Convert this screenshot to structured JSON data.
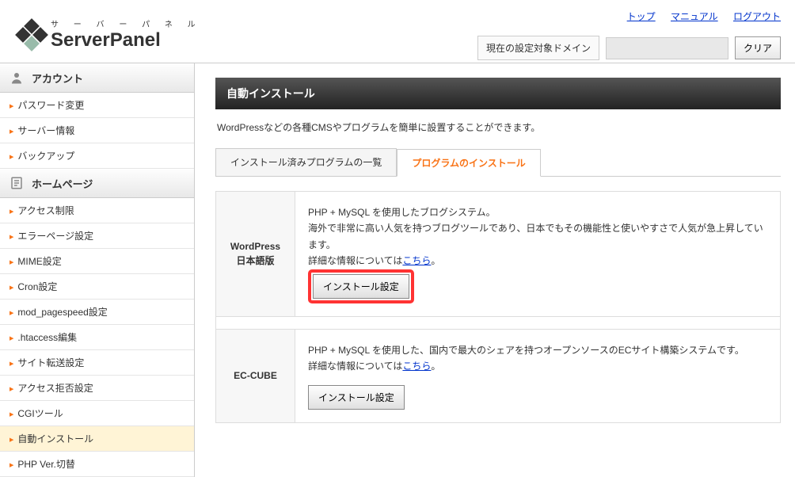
{
  "header": {
    "logo_kana": "サ ー バ ー パ ネ ル",
    "logo_main": "ServerPanel",
    "top_links": [
      "トップ",
      "マニュアル",
      "ログアウト"
    ],
    "domain_label": "現在の設定対象ドメイン",
    "clear_button": "クリア"
  },
  "sidebar": {
    "sections": [
      {
        "title": "アカウント",
        "items": [
          "パスワード変更",
          "サーバー情報",
          "バックアップ"
        ]
      },
      {
        "title": "ホームページ",
        "items": [
          "アクセス制限",
          "エラーページ設定",
          "MIME設定",
          "Cron設定",
          "mod_pagespeed設定",
          ".htaccess編集",
          "サイト転送設定",
          "アクセス拒否設定",
          "CGIツール",
          "自動インストール",
          "PHP Ver.切替"
        ]
      }
    ],
    "active_item": "自動インストール"
  },
  "main": {
    "title": "自動インストール",
    "description": "WordPressなどの各種CMSやプログラムを簡単に設置することができます。",
    "tabs": [
      "インストール済みプログラムの一覧",
      "プログラムのインストール"
    ],
    "active_tab_index": 1,
    "programs": [
      {
        "name": "WordPress\n日本語版",
        "desc_lines": [
          "PHP + MySQL を使用したブログシステム。",
          "海外で非常に高い人気を持つブログツールであり、日本でもその機能性と使いやすさで人気が急上昇しています。"
        ],
        "detail_prefix": "詳細な情報については",
        "detail_link": "こちら",
        "detail_suffix": "。",
        "button": "インストール設定",
        "highlighted": true
      },
      {
        "name": "EC-CUBE",
        "desc_lines": [
          "PHP + MySQL を使用した、国内で最大のシェアを持つオープンソースのECサイト構築システムです。"
        ],
        "detail_prefix": "詳細な情報については",
        "detail_link": "こちら",
        "detail_suffix": "。",
        "button": "インストール設定",
        "highlighted": false
      }
    ]
  }
}
